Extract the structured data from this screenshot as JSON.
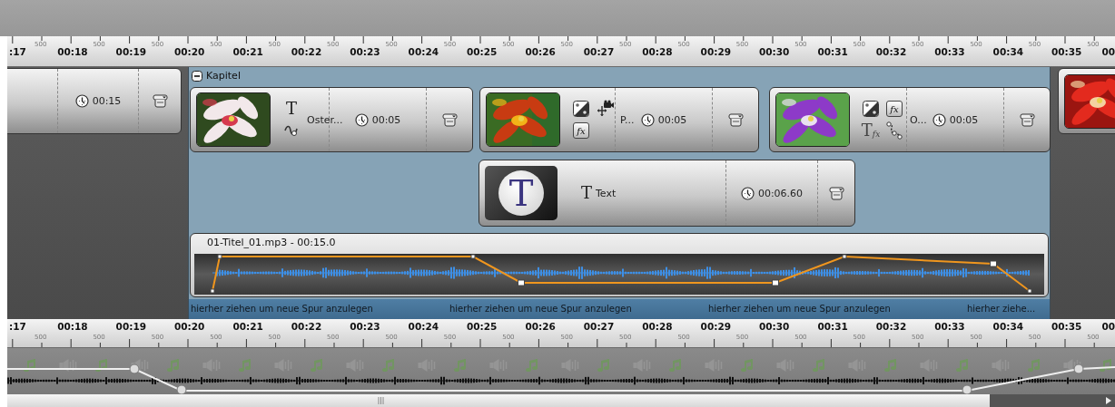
{
  "ruler_top": {
    "labels": [
      ":17",
      "00:18",
      "00:19",
      "00:20",
      "00:21",
      "00:22",
      "00:23",
      "00:24",
      "00:25",
      "00:26",
      "00:27",
      "00:28",
      "00:29",
      "00:30",
      "00:31",
      "00:32",
      "00:33",
      "00:34",
      "00:35",
      "00"
    ],
    "minor_labels": [
      "500",
      "500",
      "500",
      "500",
      "500",
      "500",
      "500",
      "500",
      "500",
      "500",
      "500",
      "500",
      "500",
      "500",
      "500",
      "500",
      "500",
      "500",
      "500"
    ]
  },
  "tracks": {
    "clips": [
      {
        "kind": "partial-left",
        "duration": "00:15"
      },
      {
        "kind": "partial-right",
        "thumb": {
          "kind": "picture"
        }
      }
    ],
    "chapter": {
      "title": "Kapitel",
      "expanded": true,
      "clips": [
        {
          "thumb": {
            "kind": "picture"
          },
          "title": "Oster...",
          "duration": "00:05",
          "icons": [
            {
              "kind": "glyph",
              "text": "T"
            },
            {
              "kind": "transition"
            }
          ]
        },
        {
          "thumb": {
            "kind": "picture"
          },
          "title": "P...",
          "duration": "00:05",
          "icons": [
            {
              "kind": "blend"
            },
            {
              "kind": "fx",
              "text": "fx"
            },
            {
              "kind": "camera"
            }
          ]
        },
        {
          "thumb": {
            "kind": "picture"
          },
          "title": "O...",
          "duration": "00:05",
          "icons": [
            {
              "kind": "blend"
            },
            {
              "kind": "text-fx",
              "text": "T",
              "sub": "fx"
            },
            {
              "kind": "fx",
              "text": "fx"
            },
            {
              "kind": "path"
            }
          ]
        }
      ],
      "text_clip": {
        "thumb_letter": "T",
        "glyph": "T",
        "title": "Text",
        "duration": "00:06.60"
      },
      "audio_clip": {
        "title": "01-Titel_01.mp3 - 00:15.0"
      },
      "drop_hints": [
        "hierher ziehen um neue Spur anzulegen",
        "hierher ziehen um neue Spur anzulegen",
        "hierher ziehen um neue Spur anzulegen",
        "hierher ziehe..."
      ]
    }
  },
  "ruler_bottom": {
    "labels": [
      ":17",
      "00:18",
      "00:19",
      "00:20",
      "00:21",
      "00:22",
      "00:23",
      "00:24",
      "00:25",
      "00:26",
      "00:27",
      "00:28",
      "00:29",
      "00:30",
      "00:31",
      "00:32",
      "00:33",
      "00:34",
      "00:35",
      "00"
    ],
    "minor_labels": [
      "500",
      "500",
      "500",
      "500",
      "500",
      "500",
      "500",
      "500",
      "500",
      "500",
      "500",
      "500",
      "500",
      "500",
      "500",
      "500",
      "500",
      "500",
      "500"
    ]
  }
}
